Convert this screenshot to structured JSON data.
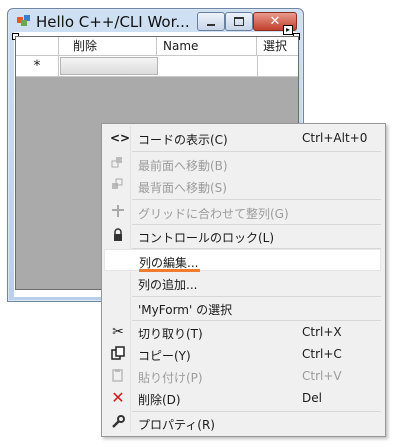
{
  "window": {
    "title": "Hello C++/CLI Wor...",
    "caption_buttons": {
      "minimize": "minimize-icon",
      "maximize": "maximize-icon",
      "close": "close-icon"
    }
  },
  "grid": {
    "columns": [
      "削除",
      "Name",
      "選択"
    ],
    "new_row_marker": "*"
  },
  "context_menu": {
    "items": [
      {
        "label": "コードの表示(C)",
        "shortcut": "Ctrl+Alt+0",
        "icon": "view-code-icon",
        "enabled": true
      },
      {
        "label": "最前面へ移動(B)",
        "shortcut": "",
        "icon": "bring-to-front-icon",
        "enabled": false
      },
      {
        "label": "最背面へ移動(S)",
        "shortcut": "",
        "icon": "send-to-back-icon",
        "enabled": false
      },
      {
        "label": "グリッドに合わせて整列(G)",
        "shortcut": "",
        "icon": "align-to-grid-icon",
        "enabled": false
      },
      {
        "label": "コントロールのロック(L)",
        "shortcut": "",
        "icon": "lock-icon",
        "enabled": true
      },
      {
        "label": "列の編集...",
        "shortcut": "",
        "icon": "",
        "enabled": true
      },
      {
        "label": "列の追加...",
        "shortcut": "",
        "icon": "",
        "enabled": true
      },
      {
        "label": "'MyForm' の選択",
        "shortcut": "",
        "icon": "",
        "enabled": true
      },
      {
        "label": "切り取り(T)",
        "shortcut": "Ctrl+X",
        "icon": "cut-icon",
        "enabled": true
      },
      {
        "label": "コピー(Y)",
        "shortcut": "Ctrl+C",
        "icon": "copy-icon",
        "enabled": true
      },
      {
        "label": "貼り付け(P)",
        "shortcut": "Ctrl+V",
        "icon": "paste-icon",
        "enabled": false
      },
      {
        "label": "削除(D)",
        "shortcut": "Del",
        "icon": "delete-icon",
        "enabled": true
      },
      {
        "label": "プロパティ(R)",
        "shortcut": "",
        "icon": "properties-icon",
        "enabled": true
      }
    ],
    "highlight_color": "#f07c2c",
    "delete_icon_color": "#d01c1c"
  }
}
